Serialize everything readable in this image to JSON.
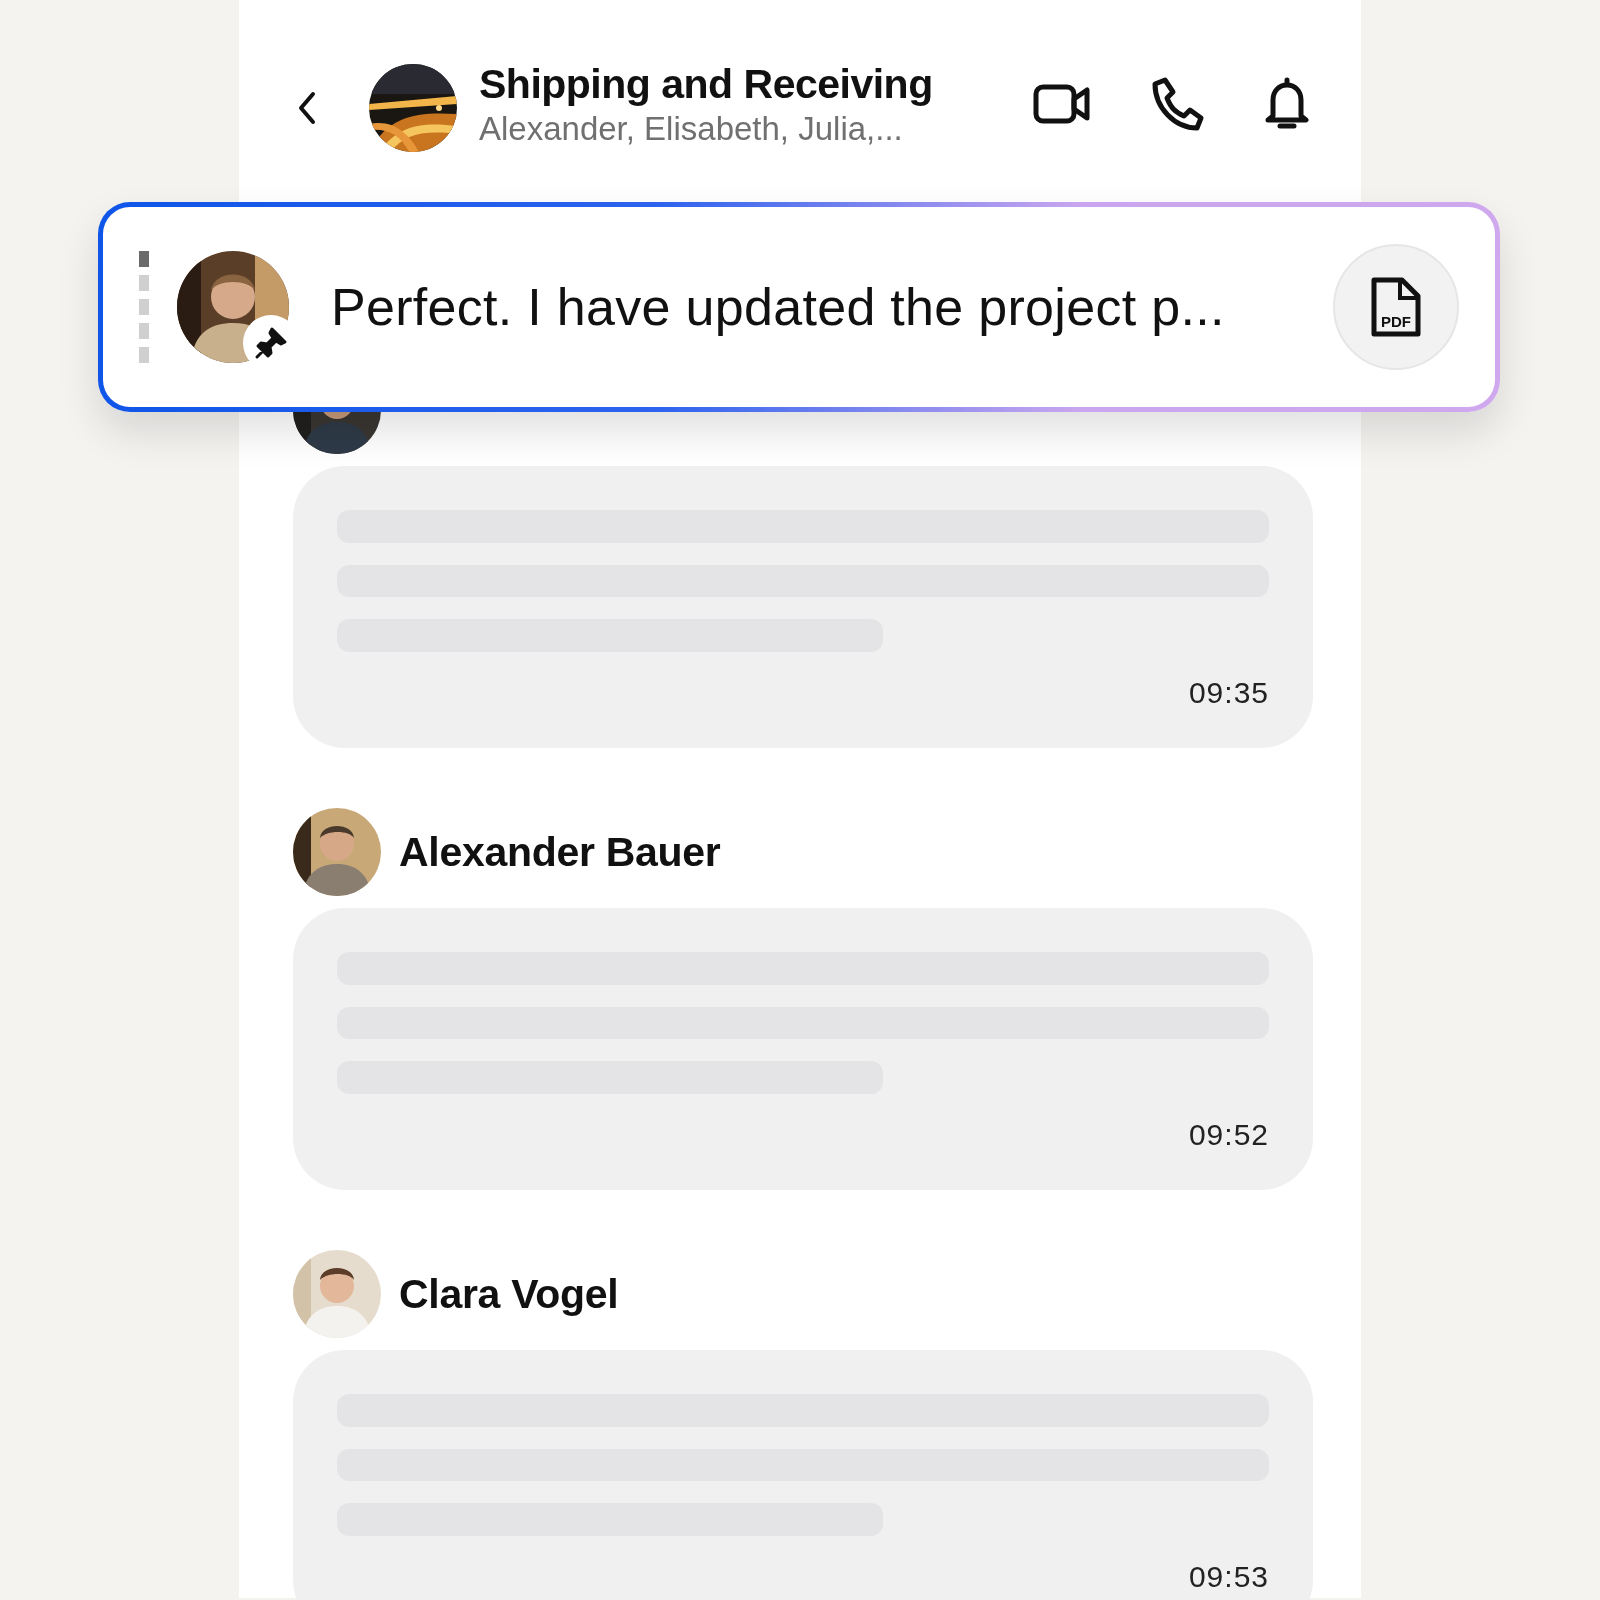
{
  "header": {
    "title": "Shipping and Receiving",
    "subtitle": "Alexander, Elisabeth, Julia,..."
  },
  "pinned": {
    "text": "Perfect. I have updated the project p...",
    "indicator": [
      {
        "selected": true
      },
      {
        "selected": false
      },
      {
        "selected": false
      },
      {
        "selected": false
      },
      {
        "selected": false
      }
    ],
    "attachment": {
      "kind": "file",
      "label": "PDF"
    }
  },
  "messages": [
    {
      "time": "09:35"
    },
    {
      "sender": "Alexander Bauer",
      "time": "09:52"
    },
    {
      "sender": "Clara Vogel",
      "time": "09:53"
    }
  ]
}
